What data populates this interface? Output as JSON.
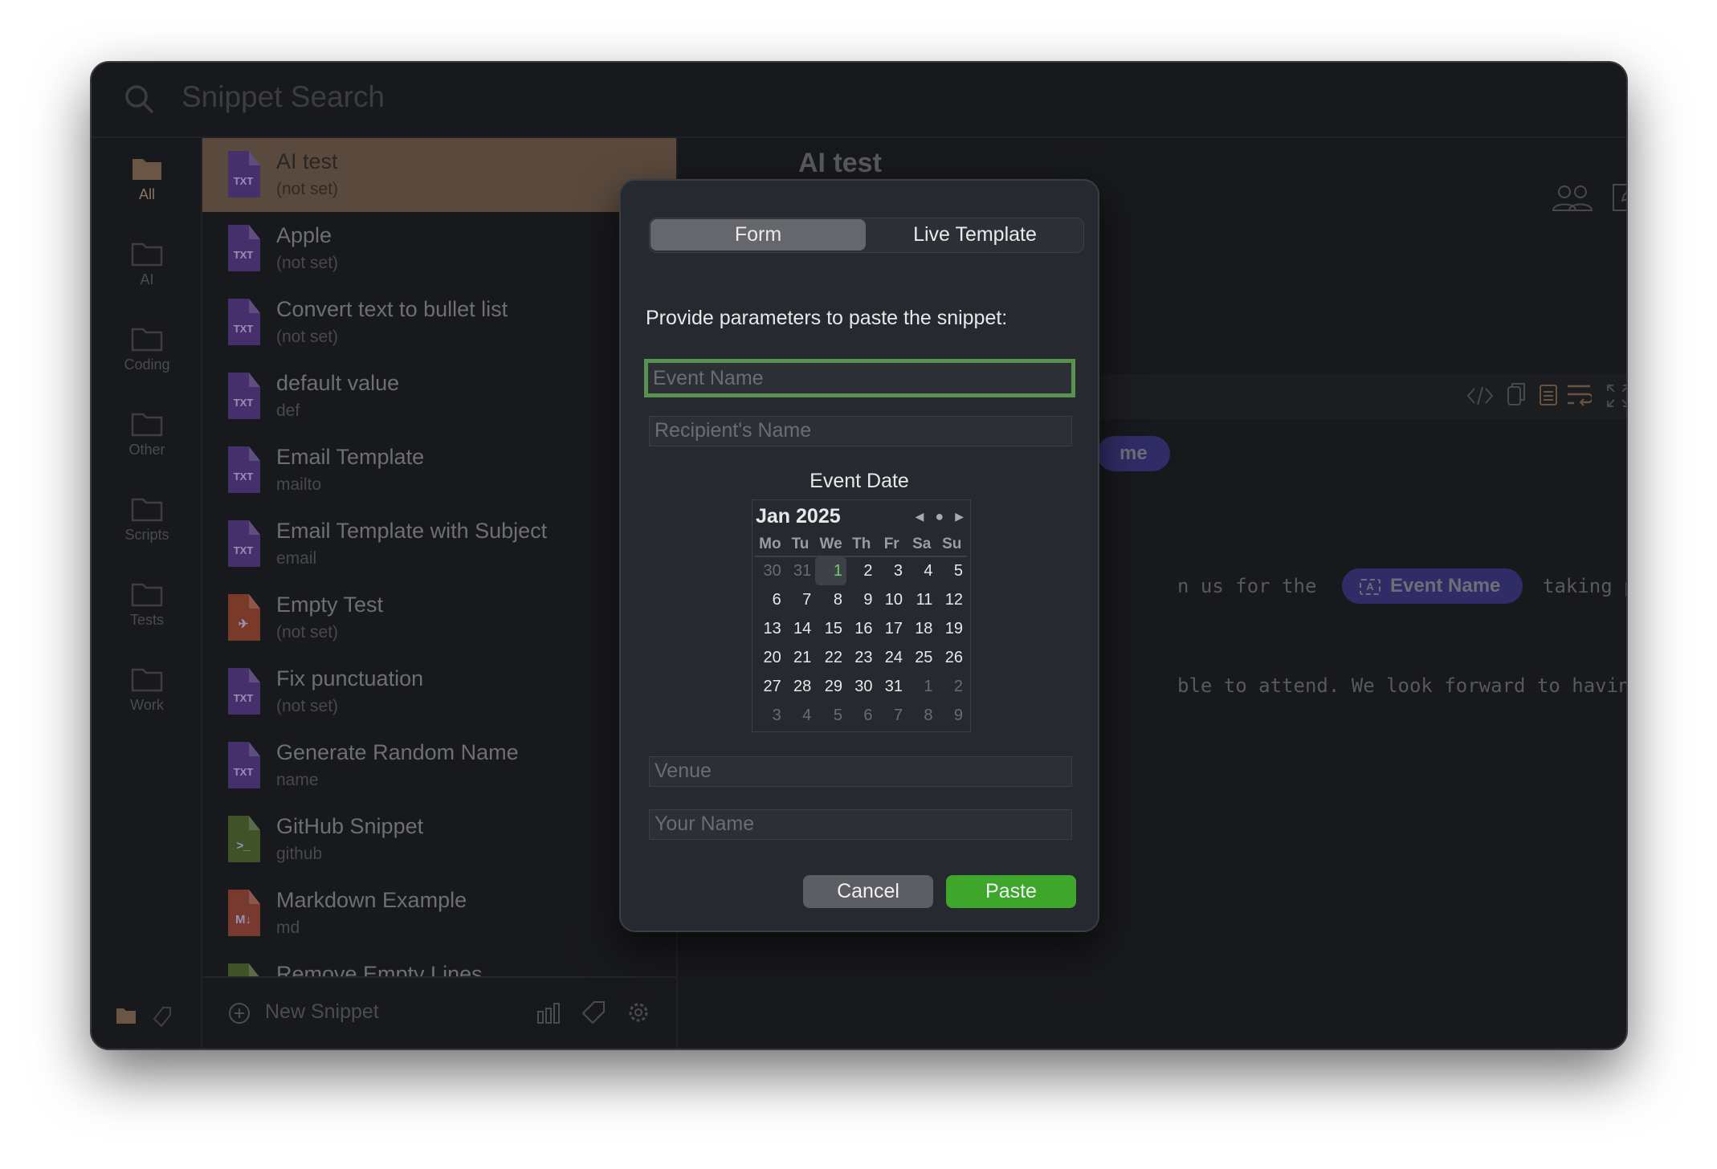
{
  "search": {
    "placeholder": "Snippet Search",
    "icon": "search-icon"
  },
  "sidebar": {
    "categories": [
      {
        "label": "All",
        "active": true
      },
      {
        "label": "AI"
      },
      {
        "label": "Coding"
      },
      {
        "label": "Other"
      },
      {
        "label": "Scripts"
      },
      {
        "label": "Tests"
      },
      {
        "label": "Work"
      }
    ]
  },
  "snippets": [
    {
      "title": "AI test",
      "subtitle": "(not set)",
      "type": "TXT",
      "selected": true
    },
    {
      "title": "Apple",
      "subtitle": "(not set)",
      "type": "TXT"
    },
    {
      "title": "Convert text to bullet list",
      "subtitle": "(not set)",
      "type": "TXT"
    },
    {
      "title": "default value",
      "subtitle": "def",
      "type": "TXT"
    },
    {
      "title": "Email Template",
      "subtitle": "mailto",
      "type": "TXT"
    },
    {
      "title": "Email Template with Subject",
      "subtitle": "email",
      "type": "TXT"
    },
    {
      "title": "Empty Test",
      "subtitle": "(not set)",
      "type": "swift"
    },
    {
      "title": "Fix punctuation",
      "subtitle": "(not set)",
      "type": "TXT"
    },
    {
      "title": "Generate Random Name",
      "subtitle": "name",
      "type": "TXT"
    },
    {
      "title": "GitHub Snippet",
      "subtitle": "github",
      "type": "shell"
    },
    {
      "title": "Markdown Example",
      "subtitle": "md",
      "type": "markdown"
    },
    {
      "title": "Remove Empty Lines",
      "subtitle": "",
      "type": "shell"
    }
  ],
  "list_footer": {
    "new_snippet": "New Snippet"
  },
  "detail": {
    "title": "AI test",
    "pill_partial": "me",
    "line1_before": "n us for the",
    "pill": "Event Name",
    "line1_after": "taking place",
    "line2": "ble to attend. We look forward to having you"
  },
  "dialog": {
    "tabs": [
      {
        "label": "Form",
        "active": true
      },
      {
        "label": "Live Template"
      }
    ],
    "prompt": "Provide parameters to paste the snippet:",
    "fields": {
      "event_name": "Event Name",
      "recipient": "Recipient's Name",
      "venue": "Venue",
      "your_name": "Your Name"
    },
    "date_label": "Event Date",
    "calendar": {
      "month": "Jan 2025",
      "weekdays": [
        "Mo",
        "Tu",
        "We",
        "Th",
        "Fr",
        "Sa",
        "Su"
      ],
      "weeks": [
        [
          "30",
          "31",
          "1",
          "2",
          "3",
          "4",
          "5"
        ],
        [
          "6",
          "7",
          "8",
          "9",
          "10",
          "11",
          "12"
        ],
        [
          "13",
          "14",
          "15",
          "16",
          "17",
          "18",
          "19"
        ],
        [
          "20",
          "21",
          "22",
          "23",
          "24",
          "25",
          "26"
        ],
        [
          "27",
          "28",
          "29",
          "30",
          "31",
          "1",
          "2"
        ],
        [
          "3",
          "4",
          "5",
          "6",
          "7",
          "8",
          "9"
        ]
      ],
      "selected": "1"
    },
    "cancel": "Cancel",
    "paste": "Paste"
  },
  "colors": {
    "accent": "#57924f",
    "paste": "#3fa62c",
    "selection": "#5a4a3d",
    "pill": "#302c66"
  }
}
